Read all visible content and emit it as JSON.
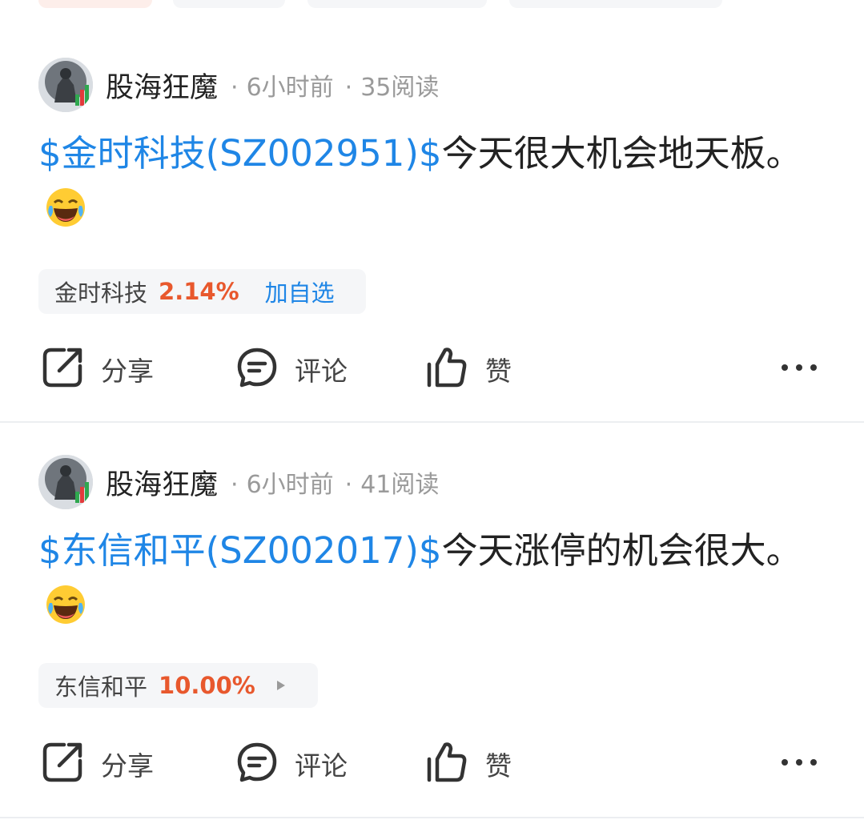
{
  "colors": {
    "link": "#1f86e6",
    "rise": "#e8582d",
    "meta": "#9a9a9a"
  },
  "icons": {
    "share": "share-icon",
    "comment": "comment-icon",
    "like": "thumbs-up-icon",
    "more": "more-icon",
    "emoji": "laughing-tears-emoji"
  },
  "posts": [
    {
      "author": "股海狂魔",
      "time": "6小时前",
      "reads": "35阅读",
      "content": {
        "stock_link": "$金时科技(SZ002951)$",
        "text": "今天很大机会地天板。"
      },
      "stock": {
        "name": "金时科技",
        "change": "2.14%",
        "action": "加自选"
      },
      "actions": {
        "share": "分享",
        "comment": "评论",
        "like": "赞"
      }
    },
    {
      "author": "股海狂魔",
      "time": "6小时前",
      "reads": "41阅读",
      "content": {
        "stock_link": "$东信和平(SZ002017)$",
        "text": "今天涨停的机会很大。"
      },
      "stock": {
        "name": "东信和平",
        "change": "10.00%"
      },
      "actions": {
        "share": "分享",
        "comment": "评论",
        "like": "赞"
      }
    }
  ]
}
